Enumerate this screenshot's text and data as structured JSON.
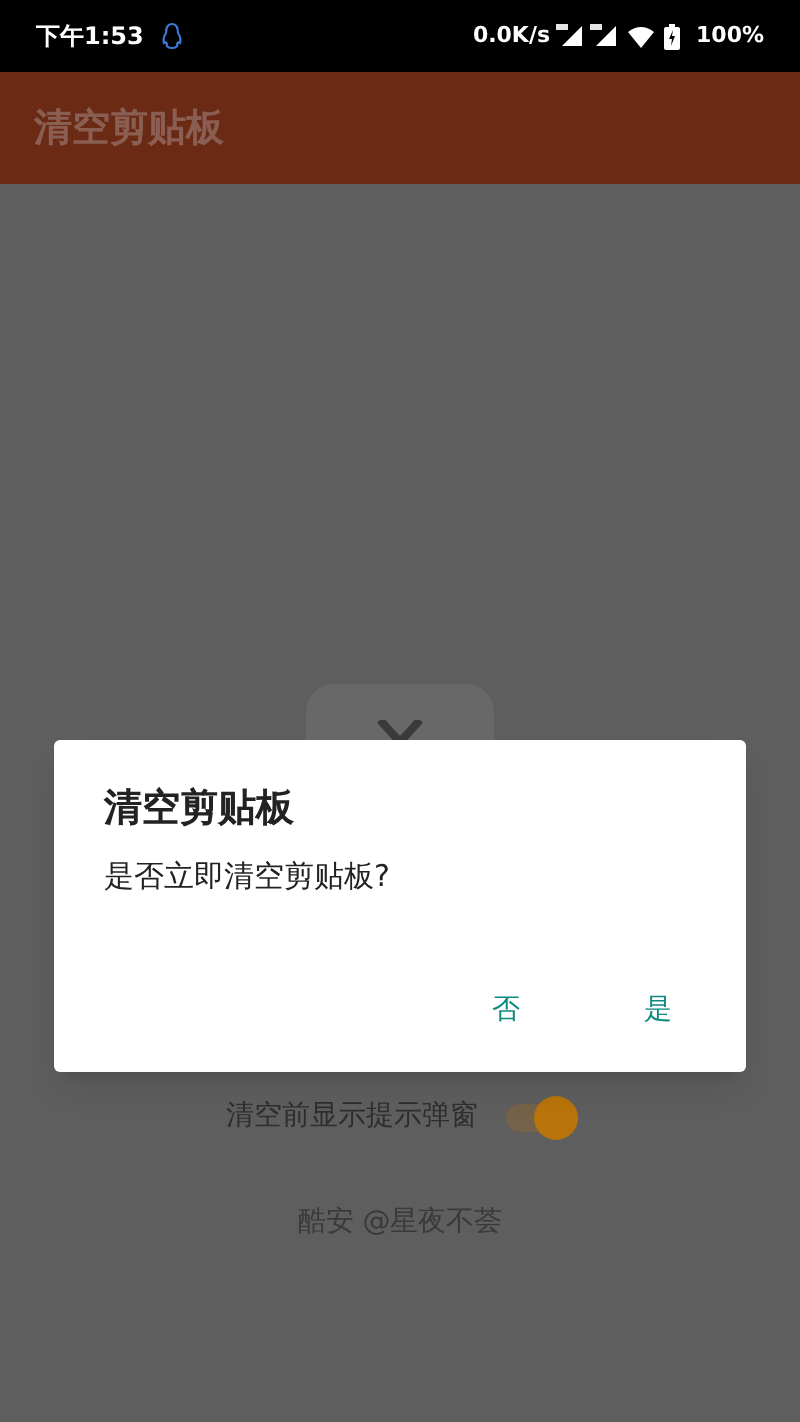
{
  "status_bar": {
    "time": "下午1:53",
    "speed": "0.0K/s",
    "battery": "100%"
  },
  "app_bar": {
    "title": "清空剪贴板"
  },
  "settings": [
    {
      "label": "清空前显示提示弹窗",
      "on": true
    }
  ],
  "footer": "酷安 @星夜不荟",
  "dialog": {
    "title": "清空剪贴板",
    "message": "是否立即清空剪贴板?",
    "buttons": [
      "否",
      "是"
    ]
  }
}
